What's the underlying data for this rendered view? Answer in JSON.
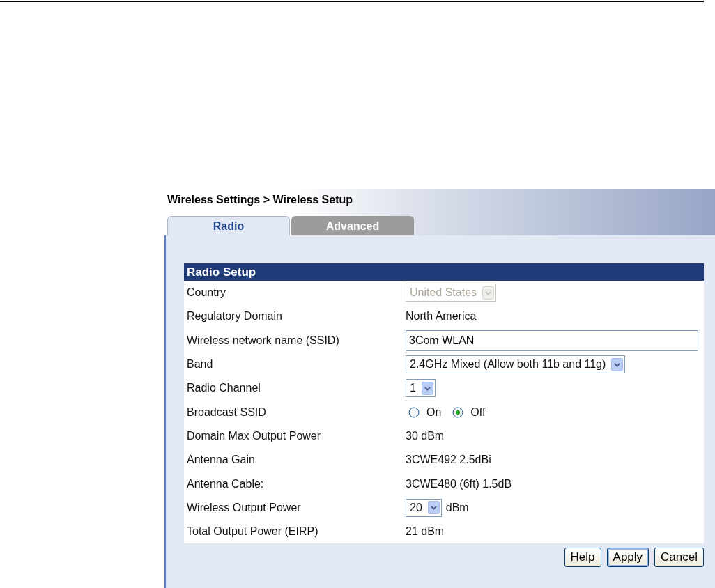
{
  "breadcrumb": "Wireless Settings > Wireless Setup",
  "tabs": [
    {
      "label": "Radio",
      "selected": true
    },
    {
      "label": "Advanced",
      "selected": false
    }
  ],
  "section_title": "Radio Setup",
  "rows": [
    {
      "label": "Country",
      "kind": "select",
      "value": "United States",
      "disabled": true
    },
    {
      "label": "Regulatory Domain",
      "kind": "text",
      "value": "North America"
    },
    {
      "label": "Wireless network name (SSID)",
      "kind": "input",
      "value": "3Com WLAN"
    },
    {
      "label": "Band",
      "kind": "select",
      "value": "2.4GHz Mixed (Allow both 11b and 11g)",
      "disabled": false
    },
    {
      "label": "Radio Channel",
      "kind": "select",
      "value": "1",
      "disabled": false
    },
    {
      "label": "Broadcast SSID",
      "kind": "radio",
      "options": [
        {
          "label": "On",
          "selected": false
        },
        {
          "label": "Off",
          "selected": true
        }
      ]
    },
    {
      "label": "Domain Max Output Power",
      "kind": "text",
      "value": "30 dBm"
    },
    {
      "label": "Antenna Gain",
      "kind": "text",
      "value": "3CWE492 2.5dBi"
    },
    {
      "label": "Antenna Cable:",
      "kind": "text",
      "value": "3CWE480 (6ft) 1.5dB"
    },
    {
      "label": "Wireless Output Power",
      "kind": "select",
      "value": "20",
      "unit": "dBm",
      "disabled": false
    },
    {
      "label": "Total Output Power (EIRP)",
      "kind": "text",
      "value": "21 dBm"
    }
  ],
  "buttons": [
    {
      "label": "Help",
      "default": false
    },
    {
      "label": "Apply",
      "default": true
    },
    {
      "label": "Cancel",
      "default": false
    }
  ]
}
